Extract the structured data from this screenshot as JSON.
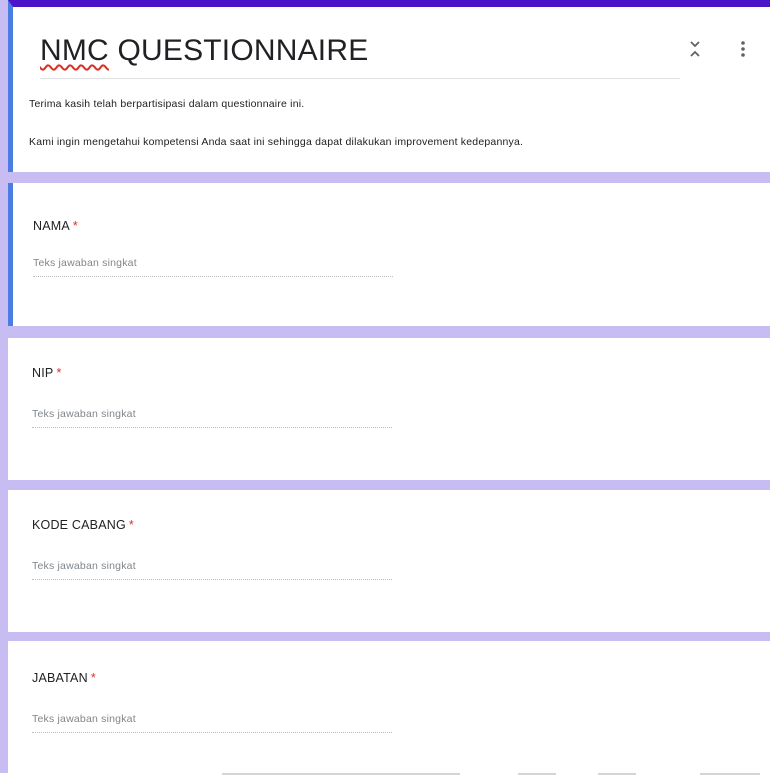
{
  "form": {
    "title_main": "NMC",
    "title_rest": " QUESTIONNAIRE",
    "description_line1": "Terima kasih telah berpartisipasi dalam questionnaire ini.",
    "description_line2": "Kami ingin mengetahui kompetensi Anda saat ini sehingga dapat dilakukan improvement kedepannya.",
    "accent_color": "#4b14c8",
    "background_color": "#c8bdf2",
    "selected_color": "#4a7de2"
  },
  "header_icons": {
    "collapse": "collapse-arrows-icon",
    "more": "more-vertical-icon"
  },
  "questions": [
    {
      "label": "NAMA",
      "required_mark": "*",
      "answer_placeholder": "Teks jawaban singkat"
    },
    {
      "label": "NIP",
      "required_mark": "*",
      "answer_placeholder": "Teks jawaban singkat"
    },
    {
      "label": "KODE CABANG",
      "required_mark": "*",
      "answer_placeholder": "Teks jawaban singkat"
    },
    {
      "label": "JABATAN",
      "required_mark": "*",
      "answer_placeholder": "Teks jawaban singkat"
    }
  ]
}
